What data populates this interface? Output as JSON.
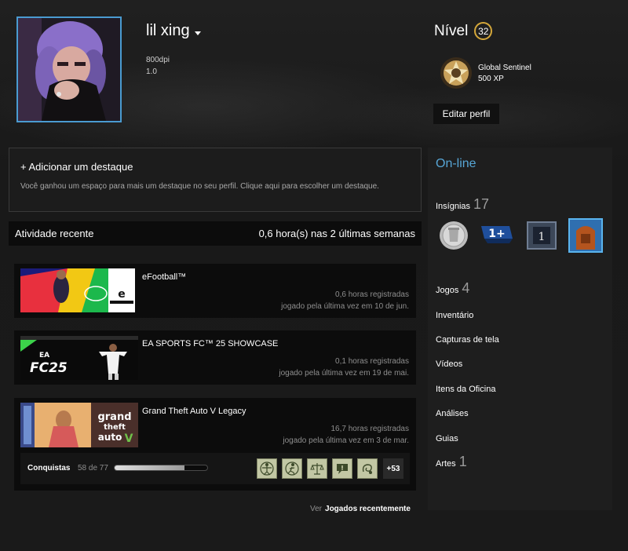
{
  "profile": {
    "username": "lil xing",
    "info_lines": [
      "800dpi",
      "1.0"
    ],
    "level_label": "Nível",
    "level": "32",
    "xp_badge_name": "Global Sentinel",
    "xp_value": "500 XP",
    "edit_profile": "Editar perfil"
  },
  "showcase": {
    "title": "+ Adicionar um destaque",
    "description": "Você ganhou um espaço para mais um destaque no seu perfil. Clique aqui para escolher um destaque."
  },
  "recent_activity": {
    "title": "Atividade recente",
    "hours_summary": "0,6 hora(s) nas 2 últimas semanas",
    "games": [
      {
        "name": "eFootball™",
        "hours": "0,6 horas registradas",
        "last_played": "jogado pela última vez em 10 de jun."
      },
      {
        "name": "EA SPORTS FC™ 25 SHOWCASE",
        "hours": "0,1 horas registradas",
        "last_played": "jogado pela última vez em 19 de mai."
      },
      {
        "name": "Grand Theft Auto V Legacy",
        "hours": "16,7 horas registradas",
        "last_played": "jogado pela última vez em 3 de mar."
      }
    ],
    "achievements": {
      "label": "Conquistas",
      "count_text": "58 de 77",
      "progress_fraction": 0.753,
      "more": "+53",
      "icons": [
        "vitruvian-achievement-icon",
        "runner-achievement-icon",
        "scales-achievement-icon",
        "speech-achievement-icon",
        "swirl-achievement-icon"
      ]
    },
    "view_prefix": "Ver",
    "view_link": "Jogados recentemente"
  },
  "sidebar": {
    "status": "On-line",
    "badges_label": "Insígnias",
    "badges_count": "17",
    "badge_texts": [
      "1+",
      "1"
    ],
    "nav": [
      {
        "label": "Jogos",
        "count": "4"
      },
      {
        "label": "Inventário",
        "count": ""
      },
      {
        "label": "Capturas de tela",
        "count": ""
      },
      {
        "label": "Vídeos",
        "count": ""
      },
      {
        "label": "Itens da Oficina",
        "count": ""
      },
      {
        "label": "Análises",
        "count": ""
      },
      {
        "label": "Guias",
        "count": ""
      },
      {
        "label": "Artes",
        "count": "1"
      }
    ]
  },
  "colors": {
    "accent_online": "#57a6d6",
    "level_ring": "#d4a73a",
    "avatar_border": "#4a9bd1"
  }
}
